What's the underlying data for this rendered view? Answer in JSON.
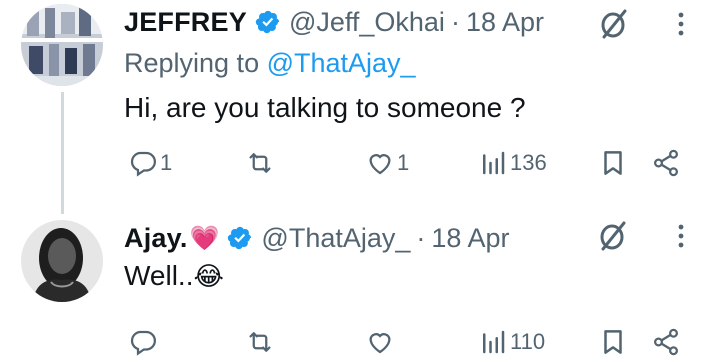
{
  "tweets": [
    {
      "author": {
        "name": "JEFFREY",
        "name_emoji": "",
        "handle": "@Jeff_Okhai",
        "verified": true
      },
      "separator": "·",
      "date": "18 Apr",
      "replying_to": {
        "prefix": "Replying to ",
        "mention": "@ThatAjay_"
      },
      "text": "Hi, are you talking to someone ?",
      "text_emoji": "",
      "metrics": {
        "replies": "1",
        "retweets": "",
        "likes": "1",
        "views": "136"
      }
    },
    {
      "author": {
        "name": "Ajay.",
        "name_emoji": "💗",
        "handle": "@ThatAjay_",
        "verified": true
      },
      "separator": "·",
      "date": "18 Apr",
      "text": "Well..",
      "text_emoji": "😂",
      "metrics": {
        "replies": "",
        "retweets": "",
        "likes": "",
        "views": "110"
      }
    }
  ],
  "colors": {
    "text_primary": "#0f1419",
    "text_secondary": "#536471",
    "link": "#1d9bf0",
    "verified_badge": "#1d9bf0",
    "thread_line": "#cfd9de"
  },
  "icons": [
    "verified-badge-icon",
    "grok-icon",
    "more-options-icon",
    "reply-icon",
    "retweet-icon",
    "like-icon",
    "views-icon",
    "bookmark-icon",
    "share-icon"
  ]
}
